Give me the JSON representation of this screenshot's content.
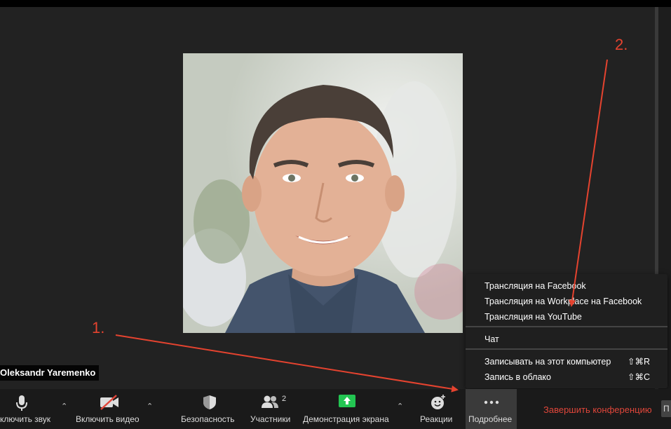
{
  "participant": {
    "name": "Oleksandr Yaremenko"
  },
  "menu": {
    "items": [
      {
        "label": "Трансляция на Facebook",
        "shortcut": ""
      },
      {
        "label": "Трансляция на Workplace на Facebook",
        "shortcut": ""
      },
      {
        "label": "Трансляция на YouTube",
        "shortcut": ""
      },
      {
        "label": "Чат",
        "shortcut": ""
      },
      {
        "label": "Записывать на этот компьютер",
        "shortcut": "⇧⌘R"
      },
      {
        "label": "Запись в облако",
        "shortcut": "⇧⌘C"
      }
    ]
  },
  "toolbar": {
    "mute_label": "ключить звук",
    "video_label": "Включить видео",
    "security_label": "Безопасность",
    "participants_label": "Участники",
    "participants_count": "2",
    "share_label": "Демонстрация экрана",
    "reactions_label": "Реакции",
    "more_label": "Подробнее",
    "end_label": "Завершить конференцию",
    "cut_label": "П"
  },
  "annotations": {
    "one": "1.",
    "two": "2."
  },
  "colors": {
    "background": "#222222",
    "toolbar": "#1a1a1a",
    "end_red": "#e0463a",
    "annotation_red": "#e5432f",
    "share_green": "#23c552"
  },
  "icons": [
    "microphone-icon",
    "video-off-icon",
    "shield-icon",
    "participants-icon",
    "share-screen-icon",
    "reaction-icon",
    "more-dots-icon",
    "caret-up-icon"
  ]
}
